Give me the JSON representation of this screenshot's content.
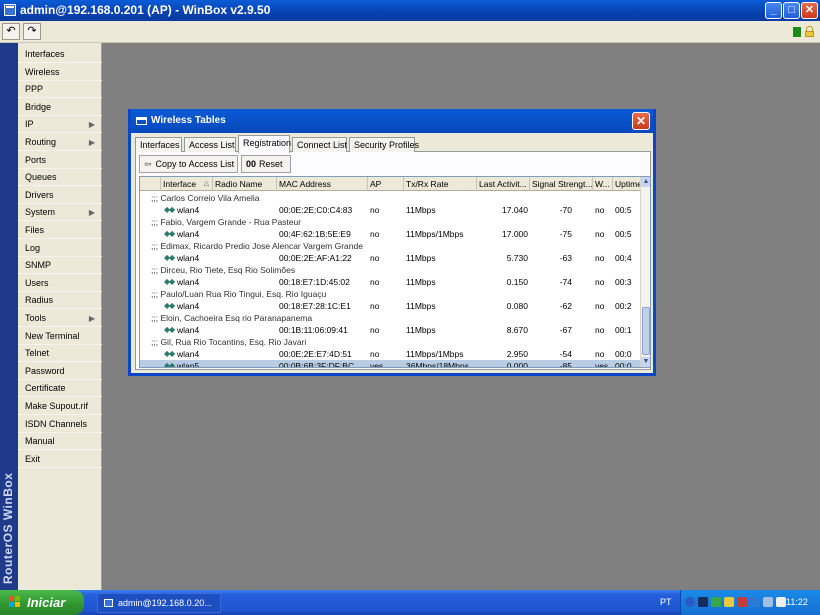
{
  "window": {
    "title": "admin@192.168.0.201 (AP) - WinBox v2.9.50",
    "minimize": "_",
    "maximize": "□",
    "close": "✕"
  },
  "toolbar": {
    "undo": "↶",
    "redo": "↷"
  },
  "brand": "RouterOS WinBox",
  "menu": [
    {
      "label": "Interfaces",
      "arrow": ""
    },
    {
      "label": "Wireless",
      "arrow": ""
    },
    {
      "label": "PPP",
      "arrow": ""
    },
    {
      "label": "Bridge",
      "arrow": ""
    },
    {
      "label": "IP",
      "arrow": "▶"
    },
    {
      "label": "Routing",
      "arrow": "▶"
    },
    {
      "label": "Ports",
      "arrow": ""
    },
    {
      "label": "Queues",
      "arrow": ""
    },
    {
      "label": "Drivers",
      "arrow": ""
    },
    {
      "label": "System",
      "arrow": "▶"
    },
    {
      "label": "Files",
      "arrow": ""
    },
    {
      "label": "Log",
      "arrow": ""
    },
    {
      "label": "SNMP",
      "arrow": ""
    },
    {
      "label": "Users",
      "arrow": ""
    },
    {
      "label": "Radius",
      "arrow": ""
    },
    {
      "label": "Tools",
      "arrow": "▶"
    },
    {
      "label": "New Terminal",
      "arrow": ""
    },
    {
      "label": "Telnet",
      "arrow": ""
    },
    {
      "label": "Password",
      "arrow": ""
    },
    {
      "label": "Certificate",
      "arrow": ""
    },
    {
      "label": "Make Supout.rif",
      "arrow": ""
    },
    {
      "label": "ISDN Channels",
      "arrow": ""
    },
    {
      "label": "Manual",
      "arrow": ""
    },
    {
      "label": "Exit",
      "arrow": ""
    }
  ],
  "wt": {
    "title": "Wireless Tables",
    "close": "✕",
    "tabs": [
      "Interfaces",
      "Access List",
      "Registration",
      "Connect List",
      "Security Profiles"
    ],
    "active_tab": "Registration",
    "copy_btn": "Copy to Access List",
    "reset_btn": "Reset",
    "reset_icon": "00",
    "copy_icon": "⇦",
    "columns": [
      "Interface",
      "Radio Name",
      "MAC Address",
      "AP",
      "Tx/Rx Rate",
      "Last Activit...",
      "Signal Strengt...",
      "W...",
      "Uptime"
    ],
    "sort_indicator": "△",
    "scroll_up": "▲",
    "scroll_down": "▼",
    "rows": [
      {
        "type": "comment",
        "text": ";;; Carlos Correio Vila Amelia"
      },
      {
        "type": "data",
        "iface": "wlan4",
        "radio": "",
        "mac": "00:0E:2E:C0:C4:83",
        "ap": "no",
        "rate": "11Mbps",
        "last": "17.040",
        "signal": "-70",
        "w": "no",
        "uptime": "00:5"
      },
      {
        "type": "comment",
        "text": ";;; Fabio, Vargem Grande - Rua Pasteur"
      },
      {
        "type": "data",
        "iface": "wlan4",
        "radio": "",
        "mac": "00:4F:62:1B:5E:E9",
        "ap": "no",
        "rate": "11Mbps/1Mbps",
        "last": "17.000",
        "signal": "-75",
        "w": "no",
        "uptime": "00:5"
      },
      {
        "type": "comment",
        "text": ";;; Edimax, Ricardo Predio Jose Alencar Vargem Grande"
      },
      {
        "type": "data",
        "iface": "wlan4",
        "radio": "",
        "mac": "00:0E:2E:AF:A1:22",
        "ap": "no",
        "rate": "11Mbps",
        "last": "5.730",
        "signal": "-63",
        "w": "no",
        "uptime": "00:4"
      },
      {
        "type": "comment",
        "text": ";;; Dirceu, Rio Tiete, Esq Rio Solimões"
      },
      {
        "type": "data",
        "iface": "wlan4",
        "radio": "",
        "mac": "00:18:E7:1D:45:02",
        "ap": "no",
        "rate": "11Mbps",
        "last": "0.150",
        "signal": "-74",
        "w": "no",
        "uptime": "00:3"
      },
      {
        "type": "comment",
        "text": ";;; Paulo/Luan Rua Rio Tingui, Esq. Rio Iguaçu"
      },
      {
        "type": "data",
        "iface": "wlan4",
        "radio": "",
        "mac": "00:18:E7:28:1C:E1",
        "ap": "no",
        "rate": "11Mbps",
        "last": "0.080",
        "signal": "-62",
        "w": "no",
        "uptime": "00:2"
      },
      {
        "type": "comment",
        "text": ";;; Eloin, Cachoeira Esq rio Paranapanema"
      },
      {
        "type": "data",
        "iface": "wlan4",
        "radio": "",
        "mac": "00:1B:11:06:09:41",
        "ap": "no",
        "rate": "11Mbps",
        "last": "8.670",
        "signal": "-67",
        "w": "no",
        "uptime": "00:1"
      },
      {
        "type": "comment",
        "text": ";;; Gil, Rua Rio Tocantins, Esq. Rio Javari"
      },
      {
        "type": "data",
        "iface": "wlan4",
        "radio": "",
        "mac": "00:0E:2E:E7:4D:51",
        "ap": "no",
        "rate": "11Mbps/1Mbps",
        "last": "2.950",
        "signal": "-54",
        "w": "no",
        "uptime": "00:0"
      },
      {
        "type": "data",
        "selected": true,
        "iface": "wlan5",
        "radio": "",
        "mac": "00:0B:6B:3F:DF:BC",
        "ap": "yes",
        "rate": "36Mbps/18Mbps",
        "last": "0.000",
        "signal": "-85",
        "w": "yes",
        "uptime": "00:0"
      }
    ]
  },
  "taskbar": {
    "start_label": "Iniciar",
    "task_label": "admin@192.168.0.20...",
    "lang": "PT",
    "clock": "11:22"
  }
}
